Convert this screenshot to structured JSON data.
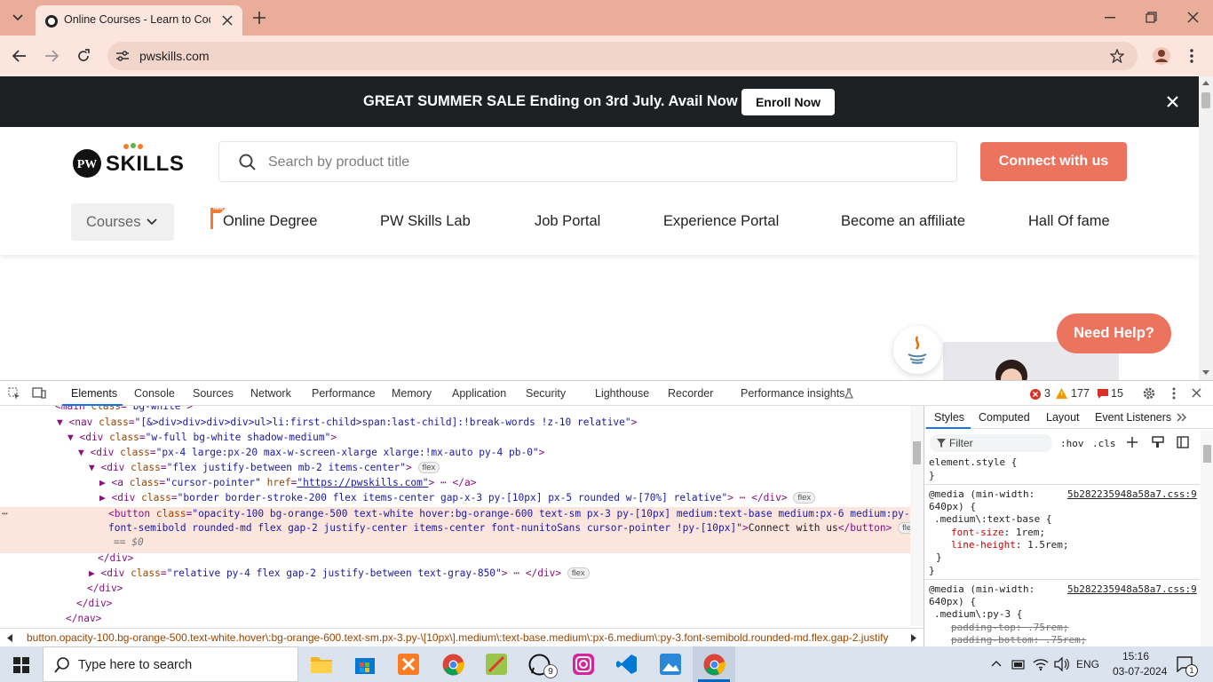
{
  "browser": {
    "tab_title": "Online Courses - Learn to Code",
    "url": "pwskills.com"
  },
  "site": {
    "banner_text": "GREAT SUMMER SALE Ending on 3rd July. Avail Now !!",
    "enroll_label": "Enroll Now",
    "logo_text": "SKILLS",
    "search_placeholder": "Search by product title",
    "connect_label": "Connect with us",
    "courses_label": "Courses",
    "nav": [
      "Online Degree",
      "PW Skills Lab",
      "Job Portal",
      "Experience Portal",
      "Become an affiliate",
      "Hall Of fame"
    ],
    "need_help": "Need Help?",
    "badge_new": "NEW"
  },
  "devtools": {
    "tabs": [
      "Elements",
      "Console",
      "Sources",
      "Network",
      "Performance",
      "Memory",
      "Application",
      "Security",
      "Lighthouse",
      "Recorder",
      "Performance insights"
    ],
    "errors": "3",
    "warnings": "177",
    "issues": "15",
    "breadcrumb": "button.opacity-100.bg-orange-500.text-white.hover\\:bg-orange-600.text-sm.px-3.py-\\[10px\\].medium\\:text-base.medium\\:px-6.medium\\:py-3.font-semibold.rounded-md.flex.gap-2.justify",
    "styles_tabs": [
      "Styles",
      "Computed",
      "Layout",
      "Event Listeners"
    ],
    "filter_placeholder": "Filter",
    "hov": ":hov",
    "cls": ".cls",
    "element_style": "element.style {",
    "media1": "@media (min-width:",
    "media1b": "640px) {",
    "css_link": "5b282235948a58a7.css:9",
    "sel1": ".medium\\:text-base {",
    "prop1": "font-size",
    "val1": "1rem;",
    "prop2": "line-height",
    "val2": "1.5rem;",
    "sel2": ".medium\\:py-3 {",
    "prop3": "padding-top",
    "val3": ".75rem;",
    "prop4": "padding-bottom",
    "val4": ".75rem;"
  },
  "taskbar": {
    "search_placeholder": "Type here to search",
    "lang": "ENG",
    "time": "15:16",
    "date": "03-07-2024",
    "whatsapp_badge": "9",
    "notif_count": "1"
  }
}
